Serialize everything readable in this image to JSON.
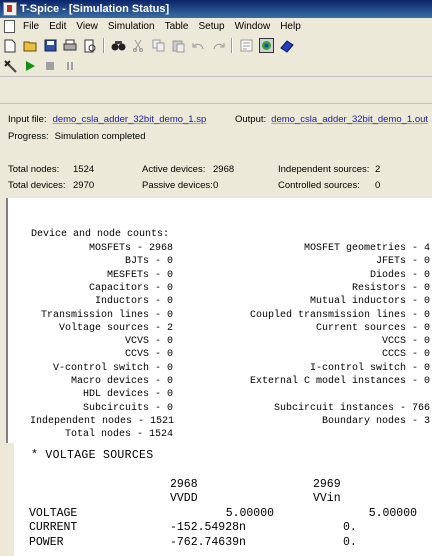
{
  "window": {
    "title": "T-Spice - [Simulation Status]"
  },
  "menu": [
    "File",
    "Edit",
    "View",
    "Simulation",
    "Table",
    "Setup",
    "Window",
    "Help"
  ],
  "toolbar1": [
    "new-icon",
    "open-icon",
    "save-icon",
    "print-icon",
    "print-preview-icon",
    "find-icon",
    "cut-icon",
    "copy-icon",
    "paste-icon",
    "undo-icon",
    "redo-icon",
    "insert-command-icon",
    "settings-icon",
    "help-icon"
  ],
  "toolbar2": [
    "build-icon",
    "run-icon",
    "stop-icon",
    "pause-icon"
  ],
  "files": {
    "input_label": "Input file:",
    "input_value": "demo_csla_adder_32bit_demo_1.sp",
    "output_label": "Output:",
    "output_value": "demo_csla_adder_32bit_demo_1.out",
    "progress_label": "Progress:",
    "progress_value": "Simulation completed"
  },
  "stats": {
    "total_nodes_label": "Total nodes:",
    "total_nodes": "1524",
    "active_devices_label": "Active devices:",
    "active_devices": "2968",
    "independent_sources_label": "Independent sources:",
    "independent_sources": "2",
    "total_devices_label": "Total devices:",
    "total_devices": "2970",
    "passive_devices_label": "Passive devices:",
    "passive_devices": "0",
    "controlled_sources_label": "Controlled sources:",
    "controlled_sources": "0"
  },
  "output": {
    "header": "Device and node counts:",
    "left": [
      "MOSFETs - 2968",
      "BJTs - 0",
      "MESFETs - 0",
      "Capacitors - 0",
      "Inductors - 0",
      "Transmission lines - 0",
      "Voltage sources - 2",
      "VCVS - 0",
      "CCVS - 0",
      "V-control switch - 0",
      "Macro devices - 0",
      "HDL devices - 0",
      "Subcircuits - 0",
      "Independent nodes - 1521",
      "Total nodes - 1524"
    ],
    "right": [
      "MOSFET geometries - 4",
      "JFETs - 0",
      "Diodes - 0",
      "Resistors - 0",
      "Mutual inductors - 0",
      "Coupled transmission lines - 0",
      "Current sources - 0",
      "VCCS - 0",
      "CCCS - 0",
      "I-control switch - 0",
      "External C model instances - 0",
      "",
      "Subcircuit instances - 766",
      "Boundary nodes - 3",
      ""
    ],
    "voltage_header": "* VOLTAGE SOURCES",
    "columns": [
      "2968",
      "2969"
    ],
    "column_names": [
      "VVDD",
      "VVin"
    ],
    "rows": [
      {
        "label": "VOLTAGE",
        "v1": "5.00000",
        "v2": "5.00000"
      },
      {
        "label": "CURRENT",
        "v1": "-152.54928n",
        "v2": "0."
      },
      {
        "label": "POWER",
        "v1": "-762.74639n",
        "v2": "0."
      }
    ]
  }
}
